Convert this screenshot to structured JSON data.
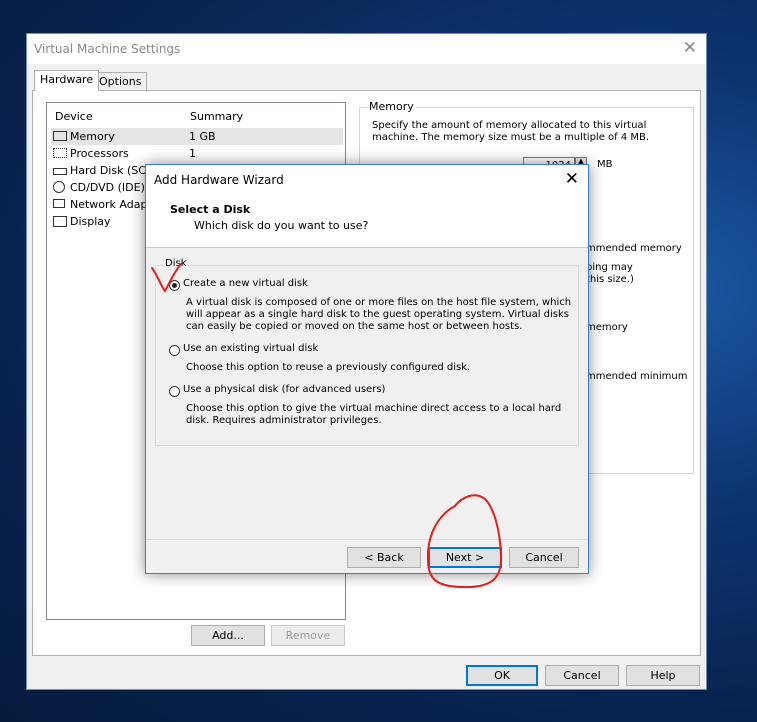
{
  "window": {
    "title": "Virtual Machine Settings",
    "close": "✕",
    "tabs": [
      "Hardware",
      "Options"
    ]
  },
  "devices": {
    "headers": {
      "device": "Device",
      "summary": "Summary"
    },
    "rows": [
      {
        "name": "Memory",
        "summary": "1 GB",
        "icon": "memory-icon"
      },
      {
        "name": "Processors",
        "summary": "1",
        "icon": "processor-icon"
      },
      {
        "name": "Hard Disk (SCSI)",
        "summary": "",
        "icon": "hard-disk-icon"
      },
      {
        "name": "CD/DVD (IDE)",
        "summary": "",
        "icon": "cd-dvd-icon"
      },
      {
        "name": "Network Adapter",
        "summary": "",
        "icon": "network-icon"
      },
      {
        "name": "Display",
        "summary": "",
        "icon": "display-icon"
      }
    ],
    "add_label": "Add...",
    "remove_label": "Remove"
  },
  "memory_panel": {
    "legend": "Memory",
    "description": "Specify the amount of memory allocated to this virtual machine. The memory size must be a multiple of 4 MB.",
    "value": "1024",
    "unit": "MB",
    "fragments": [
      "mmended memory",
      "ping may",
      " this size.)",
      " memory",
      "mmended minimum"
    ]
  },
  "footer": {
    "ok": "OK",
    "cancel": "Cancel",
    "help": "Help"
  },
  "wizard": {
    "title": "Add Hardware Wizard",
    "close": "✕",
    "heading": "Select a Disk",
    "subheading": "Which disk do you want to use?",
    "group_label": "Disk",
    "options": [
      {
        "label": "Create a new virtual disk",
        "desc": "A virtual disk is composed of one or more files on the host file system, which will appear as a single hard disk to the guest operating system. Virtual disks can easily be copied or moved on the same host or between hosts.",
        "checked": true
      },
      {
        "label": "Use an existing virtual disk",
        "desc": "Choose this option to reuse a previously configured disk.",
        "checked": false
      },
      {
        "label": "Use a physical disk (for advanced users)",
        "desc": "Choose this option to give the virtual machine direct access to a local hard disk. Requires administrator privileges.",
        "checked": false
      }
    ],
    "back": "< Back",
    "next": "Next >",
    "cancel": "Cancel"
  },
  "colors": {
    "annotation": "#e0201c",
    "accent": "#0078d7"
  }
}
